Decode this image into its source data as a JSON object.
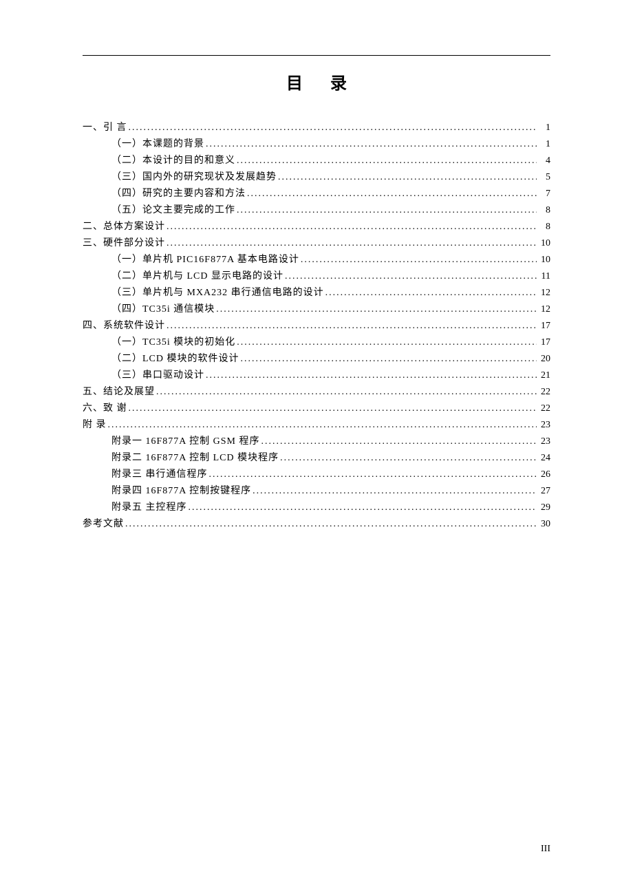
{
  "title": "目录",
  "page_number": "III",
  "entries": [
    {
      "level": 0,
      "label": "一、引 言",
      "page": "1"
    },
    {
      "level": 1,
      "label": "（一）本课题的背景",
      "page": "1"
    },
    {
      "level": 1,
      "label": "（二）本设计的目的和意义",
      "page": "4"
    },
    {
      "level": 1,
      "label": "（三）国内外的研究现状及发展趋势",
      "page": "5"
    },
    {
      "level": 1,
      "label": "（四）研究的主要内容和方法",
      "page": "7"
    },
    {
      "level": 1,
      "label": "（五）论文主要完成的工作",
      "page": "8"
    },
    {
      "level": 0,
      "label": "二、总体方案设计",
      "page": "8"
    },
    {
      "level": 0,
      "label": "三、硬件部分设计",
      "page": "10"
    },
    {
      "level": 1,
      "label": "（一）单片机 PIC16F877A 基本电路设计",
      "page": "10"
    },
    {
      "level": 1,
      "label": "（二）单片机与 LCD 显示电路的设计",
      "page": "11"
    },
    {
      "level": 1,
      "label": "（三）单片机与 MXA232 串行通信电路的设计",
      "page": "12"
    },
    {
      "level": 1,
      "label": "（四）TC35i 通信模块",
      "page": "12"
    },
    {
      "level": 0,
      "label": "四、系统软件设计",
      "page": "17"
    },
    {
      "level": 1,
      "label": "（一）TC35i 模块的初始化",
      "page": "17"
    },
    {
      "level": 1,
      "label": "（二）LCD 模块的软件设计",
      "page": "20"
    },
    {
      "level": 1,
      "label": "（三）串口驱动设计",
      "page": "21"
    },
    {
      "level": 0,
      "label": "五、结论及展望",
      "page": "22"
    },
    {
      "level": 0,
      "label": "六、致 谢",
      "page": "22"
    },
    {
      "level": 0,
      "label": "附 录",
      "page": "23"
    },
    {
      "level": 1,
      "label": "附录一 16F877A 控制 GSM 程序",
      "page": "23"
    },
    {
      "level": 1,
      "label": "附录二 16F877A 控制 LCD 模块程序",
      "page": "24"
    },
    {
      "level": 1,
      "label": "附录三 串行通信程序",
      "page": "26"
    },
    {
      "level": 1,
      "label": "附录四 16F877A 控制按键程序",
      "page": "27"
    },
    {
      "level": 1,
      "label": "附录五 主控程序",
      "page": "29"
    },
    {
      "level": 0,
      "label": "参考文献",
      "page": "30"
    }
  ]
}
